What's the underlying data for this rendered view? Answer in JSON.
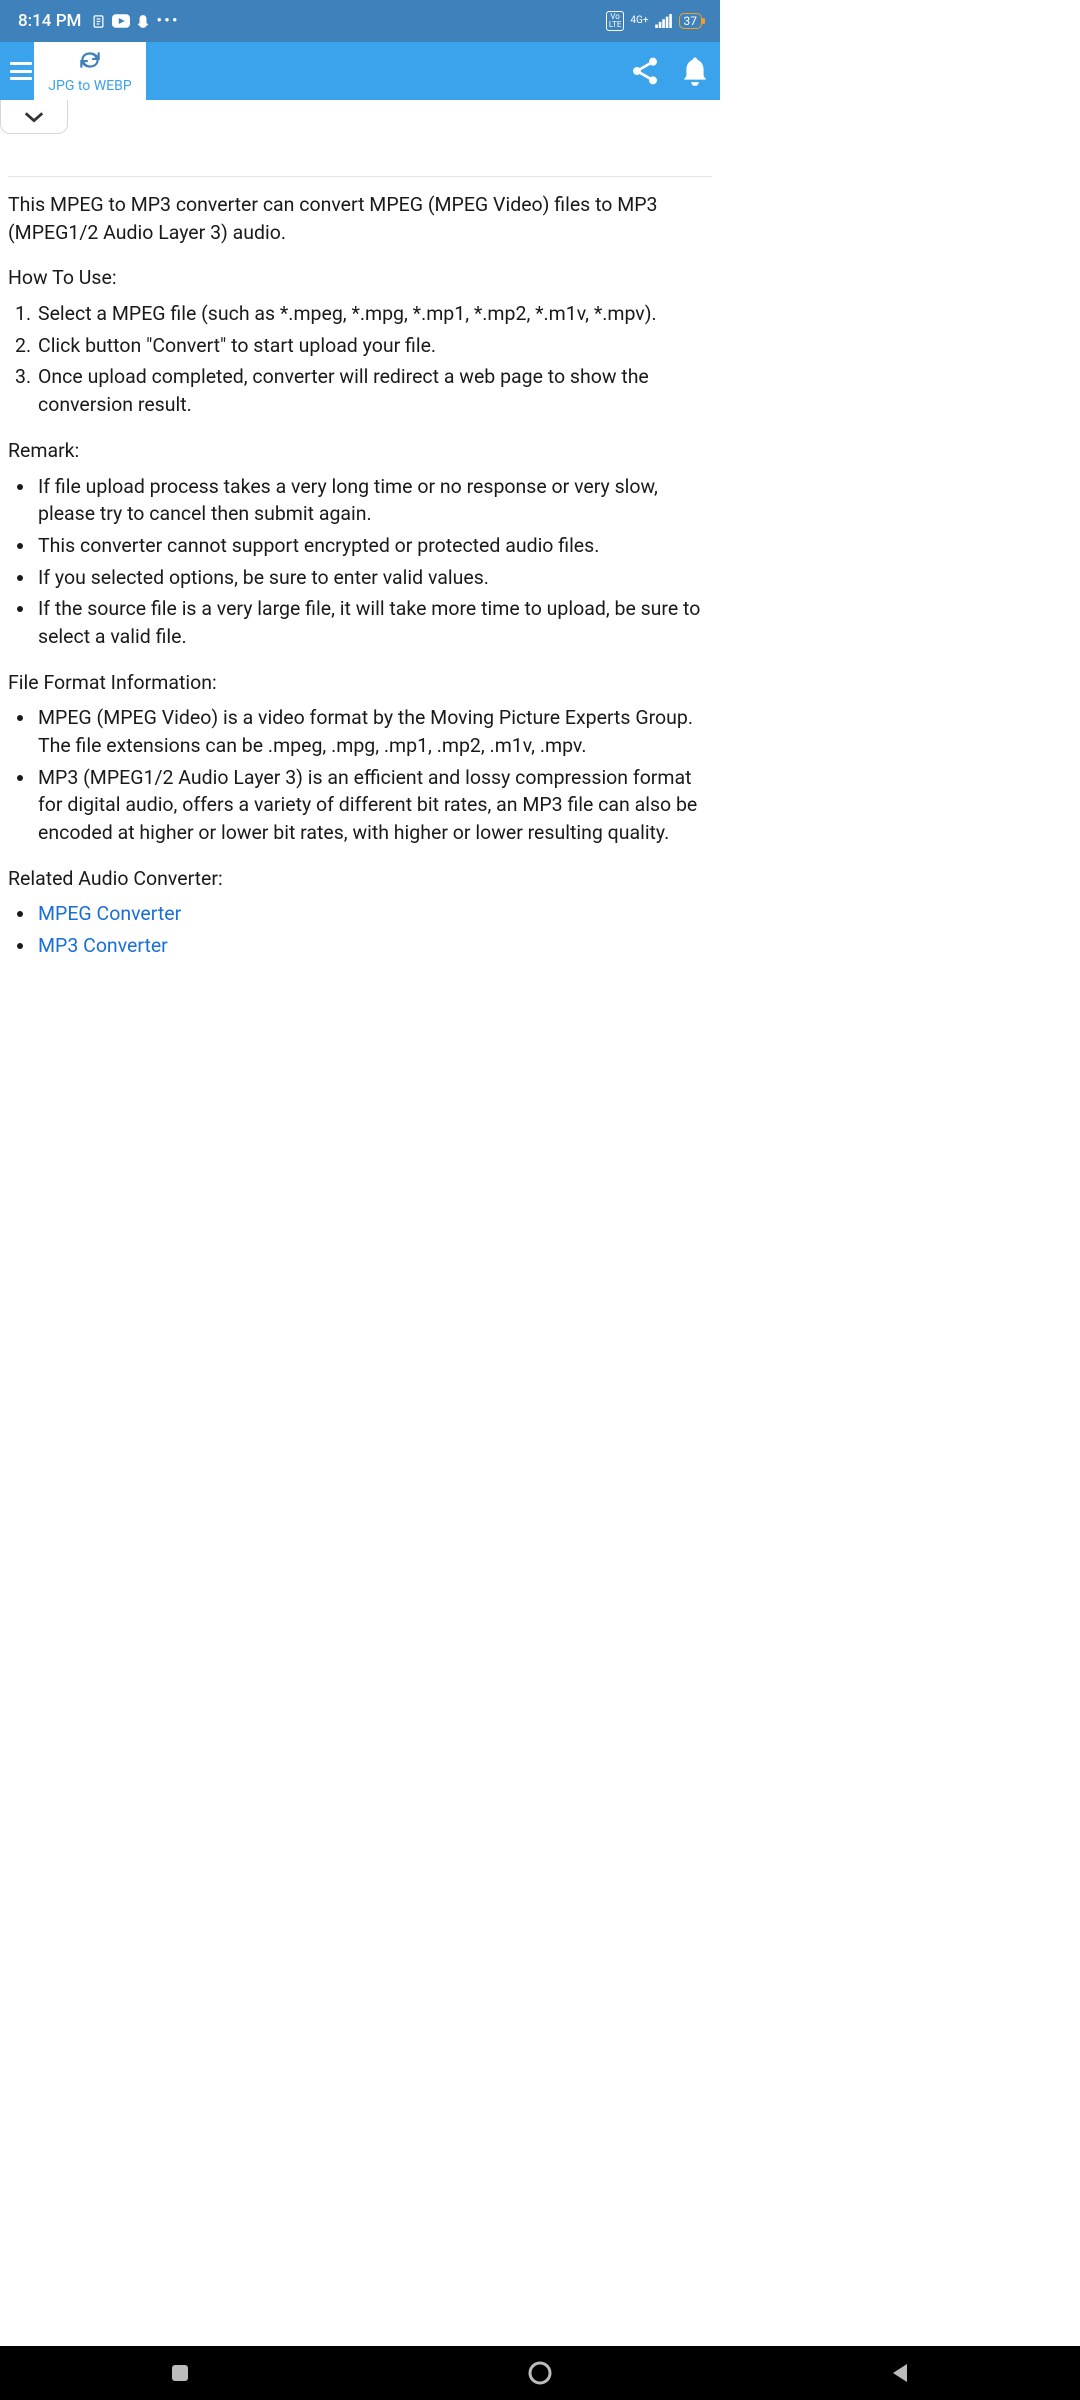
{
  "status": {
    "time": "8:14 PM",
    "network_label": "4G+",
    "vo": "Vo",
    "lte": "LTE",
    "battery": "37"
  },
  "appbar": {
    "tab_label": "JPG to WEBP"
  },
  "content": {
    "intro": "This MPEG to MP3 converter can convert MPEG (MPEG Video) files to MP3 (MPEG1/2 Audio Layer 3) audio.",
    "howto_heading": "How To Use:",
    "howto": [
      "Select a MPEG file (such as *.mpeg, *.mpg, *.mp1, *.mp2, *.m1v, *.mpv).",
      "Click button \"Convert\" to start upload your file.",
      "Once upload completed, converter will redirect a web page to show the conversion result."
    ],
    "remark_heading": "Remark:",
    "remarks": [
      "If file upload process takes a very long time or no response or very slow, please try to cancel then submit again.",
      "This converter cannot support encrypted or protected audio files.",
      "If you selected options, be sure to enter valid values.",
      "If the source file is a very large file, it will take more time to upload, be sure to select a valid file."
    ],
    "format_heading": "File Format Information:",
    "formats": [
      "MPEG (MPEG Video) is a video format by the Moving Picture Experts Group. The file extensions can be .mpeg, .mpg, .mp1, .mp2, .m1v, .mpv.",
      "MP3 (MPEG1/2 Audio Layer 3) is an efficient and lossy compression format for digital audio, offers a variety of different bit rates, an MP3 file can also be encoded at higher or lower bit rates, with higher or lower resulting quality."
    ],
    "related_heading": "Related Audio Converter:",
    "related": [
      "MPEG Converter",
      "MP3 Converter"
    ]
  }
}
